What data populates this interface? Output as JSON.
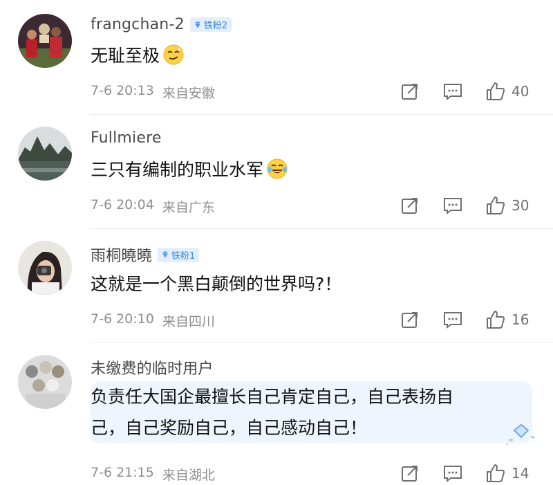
{
  "comments": [
    {
      "username": "frangchan-2",
      "badge": "铁粉2",
      "text": "无耻至极",
      "emoji_icon": "smirk-emoji-icon",
      "time": "7-6 20:13",
      "location": "来自安徽",
      "likes": "40"
    },
    {
      "username": "Fullmiere",
      "badge": "",
      "text": "三只有编制的职业水军",
      "emoji_icon": "tears-of-joy-emoji-icon",
      "time": "7-6 20:04",
      "location": "来自广东",
      "likes": "30"
    },
    {
      "username": "雨桐曉曉",
      "badge": "铁粉1",
      "text": "这就是一个黑白颠倒的世界吗?！",
      "time": "7-6 20:10",
      "location": "来自四川",
      "likes": "16"
    },
    {
      "username": "未缴费的临时用户",
      "badge": "",
      "text_line1": "负责任大国企最擅长自己肯定自己，自己表扬自",
      "text_line2": "己，自己奖励自己，自己感动自己！",
      "time": "7-6 21:15",
      "location": "来自湖北",
      "likes": "14"
    }
  ],
  "colors": {
    "badge_bg": "#e3effd",
    "badge_text": "#3a86e0",
    "meta": "#8e8e8e",
    "highlight_bg": "#eef5fd"
  }
}
